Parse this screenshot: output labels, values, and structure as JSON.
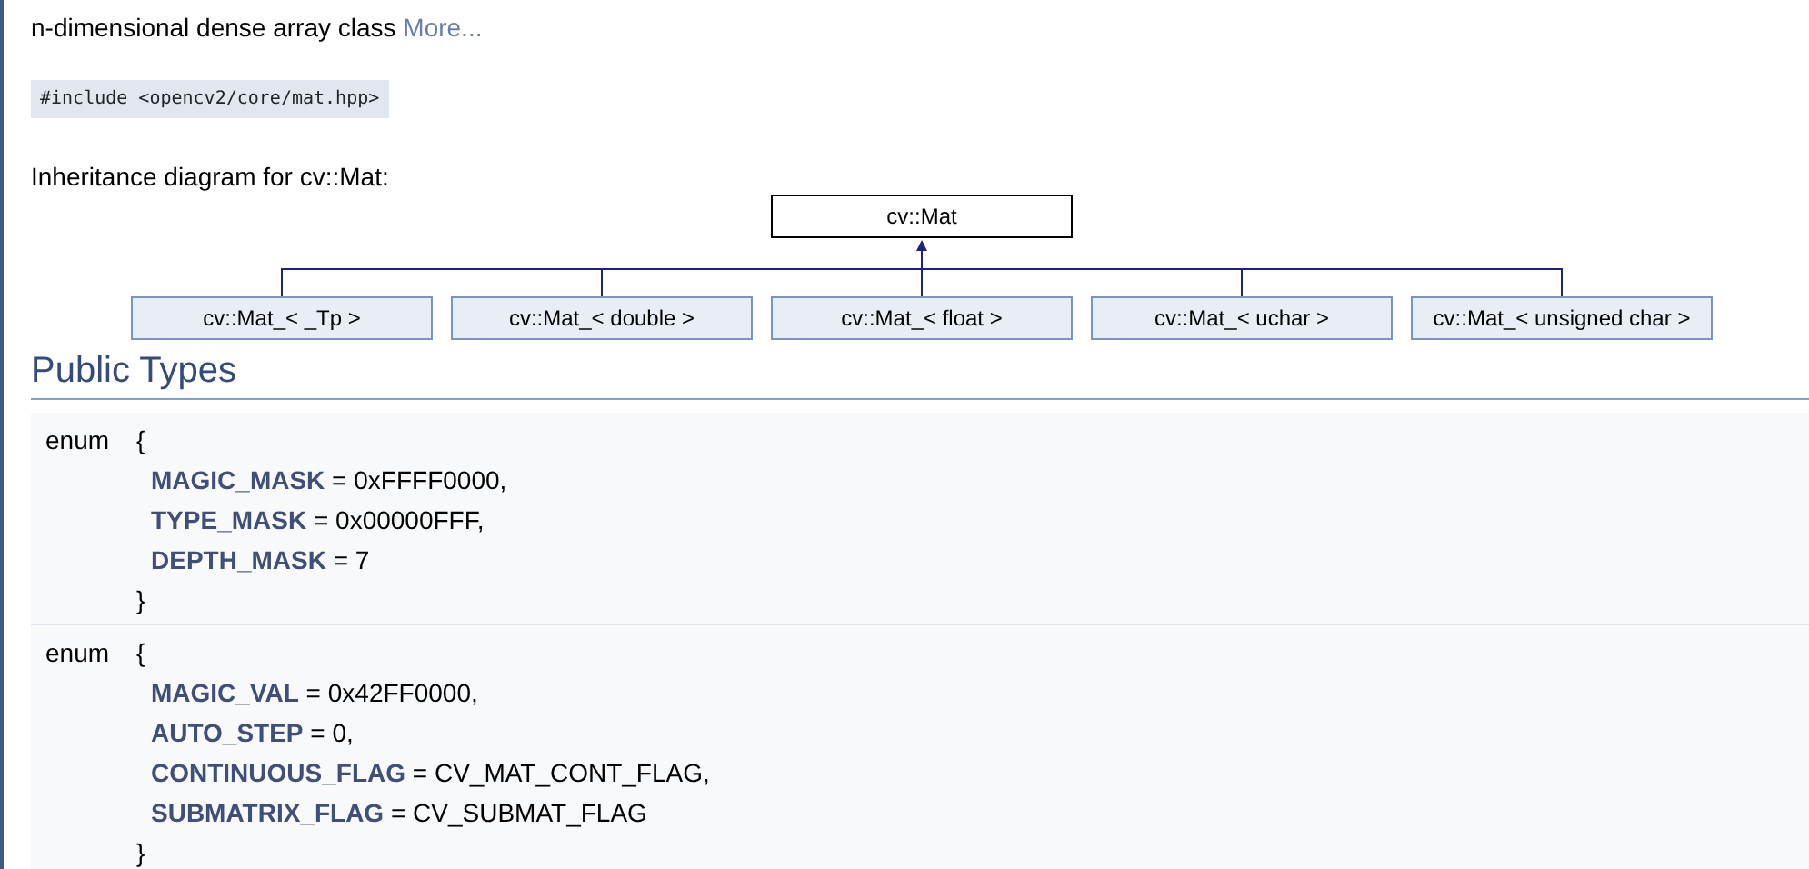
{
  "brief": {
    "text": "n-dimensional dense array class",
    "more_link": "More..."
  },
  "include": "#include <opencv2/core/mat.hpp>",
  "diagram": {
    "caption": "Inheritance diagram for cv::Mat:",
    "base": "cv::Mat",
    "derived": [
      "cv::Mat_< _Tp >",
      "cv::Mat_< double >",
      "cv::Mat_< float >",
      "cv::Mat_< uchar >",
      "cv::Mat_< unsigned char >"
    ]
  },
  "section": {
    "title": "Public Types",
    "rows": [
      {
        "keyword": "enum",
        "open": "{",
        "close": "}",
        "members": [
          "**MAGIC_MASK** = 0xFFFF0000,",
          "**TYPE_MASK** = 0x00000FFF,",
          "**DEPTH_MASK** = 7"
        ]
      },
      {
        "keyword": "enum",
        "open": "{",
        "close": "}",
        "members": [
          "**MAGIC_VAL** = 0x42FF0000,",
          "**AUTO_STEP** = 0,",
          "**CONTINUOUS_FLAG** = CV_MAT_CONT_FLAG,",
          "**SUBMATRIX_FLAG** = CV_SUBMAT_FLAG"
        ]
      }
    ]
  }
}
